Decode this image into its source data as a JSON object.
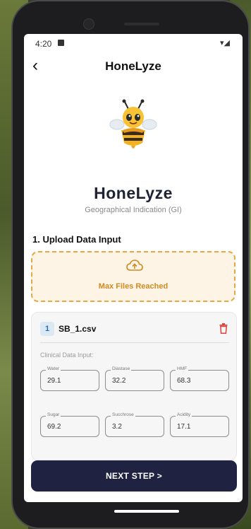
{
  "status_bar": {
    "time": "4:20",
    "signal": "▾◢"
  },
  "app_bar": {
    "title": "HoneLyze",
    "back_glyph": "‹"
  },
  "brand": {
    "name": "HoneLyze",
    "subtitle": "Geographical Indication (GI)"
  },
  "upload_section": {
    "title": "1. Upload Data Input",
    "status_text": "Max Files Reached",
    "border_color": "#e7a843",
    "icon": "cloud-upload-icon"
  },
  "file_card": {
    "index": "1",
    "file_name": "SB_1.csv",
    "clinical_label": "Clinical Data Input:",
    "fields": [
      {
        "label": "Water",
        "value": "29.1"
      },
      {
        "label": "Diastase",
        "value": "32.2"
      },
      {
        "label": "HMF",
        "value": "68.3"
      },
      {
        "label": "Sugar",
        "value": "69.2"
      },
      {
        "label": "Succhrose",
        "value": "3.2"
      },
      {
        "label": "Acidity",
        "value": "17.1"
      }
    ]
  },
  "actions": {
    "next_label": "NEXT STEP >"
  },
  "colors": {
    "primary_dark": "#1f2240",
    "accent_orange": "#e7a843",
    "delete_red": "#e0413b"
  }
}
